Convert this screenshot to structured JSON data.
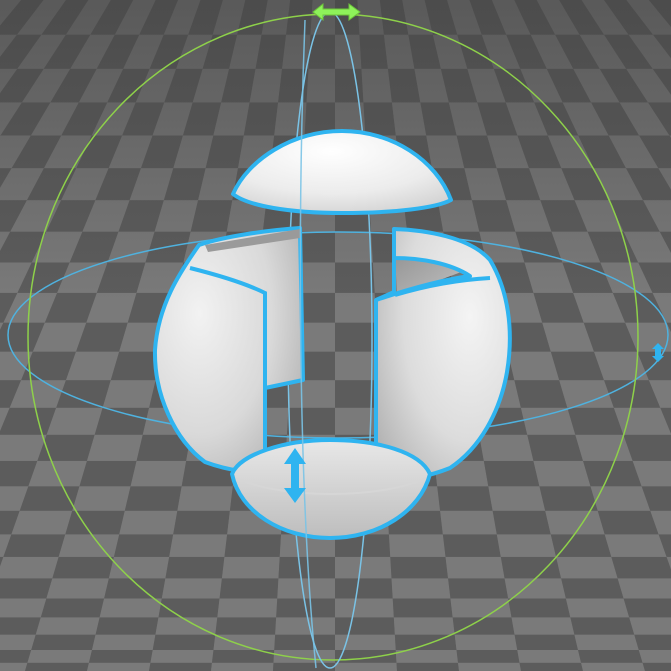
{
  "viewport": {
    "label": "3D viewport",
    "colors": {
      "floor_dark": "#5c5c5c",
      "floor_light": "#7a7a7a",
      "selection_outline": "#2fb4f0",
      "gizmo_vertical_ring": "#7ac3e6",
      "gizmo_horizontal_ring": "#4fb2df",
      "gizmo_outer_ring": "#8ed14a",
      "handle_green": "#8ef25a",
      "handle_blue": "#2fb4f0"
    }
  },
  "model": {
    "parts": [
      "top-cap",
      "left-shell",
      "right-shell",
      "bottom-cap"
    ]
  },
  "gizmo": {
    "handles": [
      "rotate-horizontal-handle",
      "rotate-tilt-handle",
      "move-vertical-handle"
    ]
  }
}
